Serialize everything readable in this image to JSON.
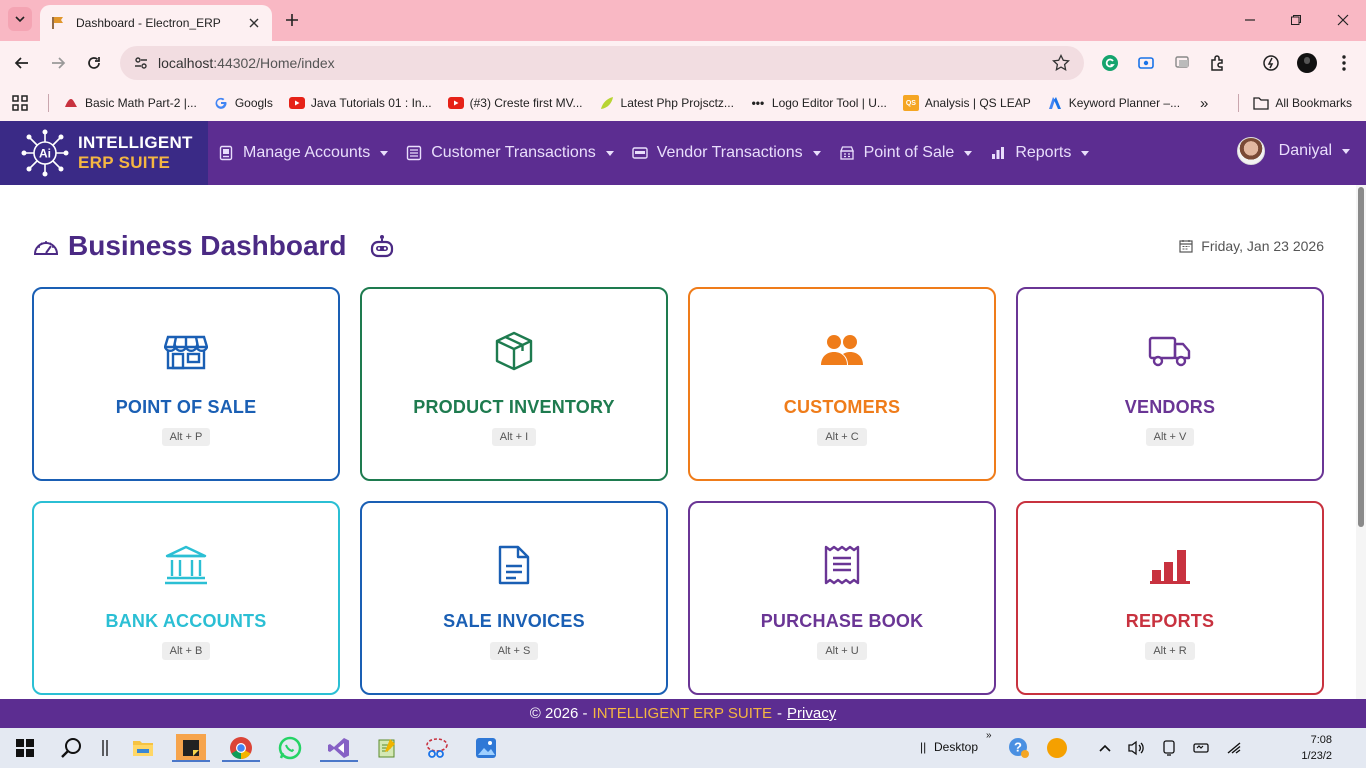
{
  "browser": {
    "tab_title": "Dashboard - Electron_ERP",
    "url_host": "localhost",
    "url_path": ":44302/Home/index",
    "bookmarks": [
      {
        "label": "Basic Math Part-2 |...",
        "icon": "bookmark-favicon-icon"
      },
      {
        "label": "Googls",
        "icon": "google-g-icon"
      },
      {
        "label": "Java Tutorials 01 : In...",
        "icon": "youtube-icon"
      },
      {
        "label": "(#3) Creste first MV...",
        "icon": "youtube-icon"
      },
      {
        "label": "Latest Php Projsctz...",
        "icon": "leaf-icon"
      },
      {
        "label": "Logo Editor Tool | U...",
        "icon": "dots-icon"
      },
      {
        "label": "Analysis | QS LEAP",
        "icon": "qs-icon"
      },
      {
        "label": "Keyword Planner –...",
        "icon": "google-ads-icon"
      }
    ],
    "bookmarks_overflow": "»",
    "all_bookmarks": "All Bookmarks"
  },
  "app": {
    "brand_line1": "INTELLIGENT",
    "brand_line2": "ERP SUITE",
    "brand_logo_text": "Ai",
    "menu": [
      {
        "label": "Manage Accounts",
        "icon": "id-card-icon"
      },
      {
        "label": "Customer Transactions",
        "icon": "list-icon"
      },
      {
        "label": "Vendor Transactions",
        "icon": "wallet-icon"
      },
      {
        "label": "Point of Sale",
        "icon": "register-icon"
      },
      {
        "label": "Reports",
        "icon": "bar-chart-icon"
      }
    ],
    "user_name": "Daniyal"
  },
  "page": {
    "title": "Business Dashboard",
    "date": "Friday, Jan 23 2026"
  },
  "cards": [
    {
      "title": "POINT OF SALE",
      "shortcut": "Alt + P",
      "color": "#1a5fb4",
      "icon": "store-icon"
    },
    {
      "title": "PRODUCT INVENTORY",
      "shortcut": "Alt + I",
      "color": "#1e7b4f",
      "icon": "box-icon"
    },
    {
      "title": "CUSTOMERS",
      "shortcut": "Alt + C",
      "color": "#ef7c1a",
      "icon": "users-icon"
    },
    {
      "title": "VENDORS",
      "shortcut": "Alt + V",
      "color": "#6a3595",
      "icon": "truck-icon"
    },
    {
      "title": "BANK ACCOUNTS",
      "shortcut": "Alt + B",
      "color": "#2bbfd4",
      "icon": "bank-icon"
    },
    {
      "title": "SALE INVOICES",
      "shortcut": "Alt + S",
      "color": "#1a5fb4",
      "icon": "invoice-icon"
    },
    {
      "title": "PURCHASE BOOK",
      "shortcut": "Alt + U",
      "color": "#6a3595",
      "icon": "receipt-icon"
    },
    {
      "title": "REPORTS",
      "shortcut": "Alt + R",
      "color": "#c8323f",
      "icon": "chart-bars-icon"
    }
  ],
  "footer": {
    "prefix": "© 2026 -",
    "brand": "INTELLIGENT ERP SUITE",
    "separator": "-",
    "privacy": "Privacy"
  },
  "taskbar": {
    "desktop_label": "Desktop",
    "overflow": "»",
    "time": "7:08",
    "date": "1/23/2"
  }
}
